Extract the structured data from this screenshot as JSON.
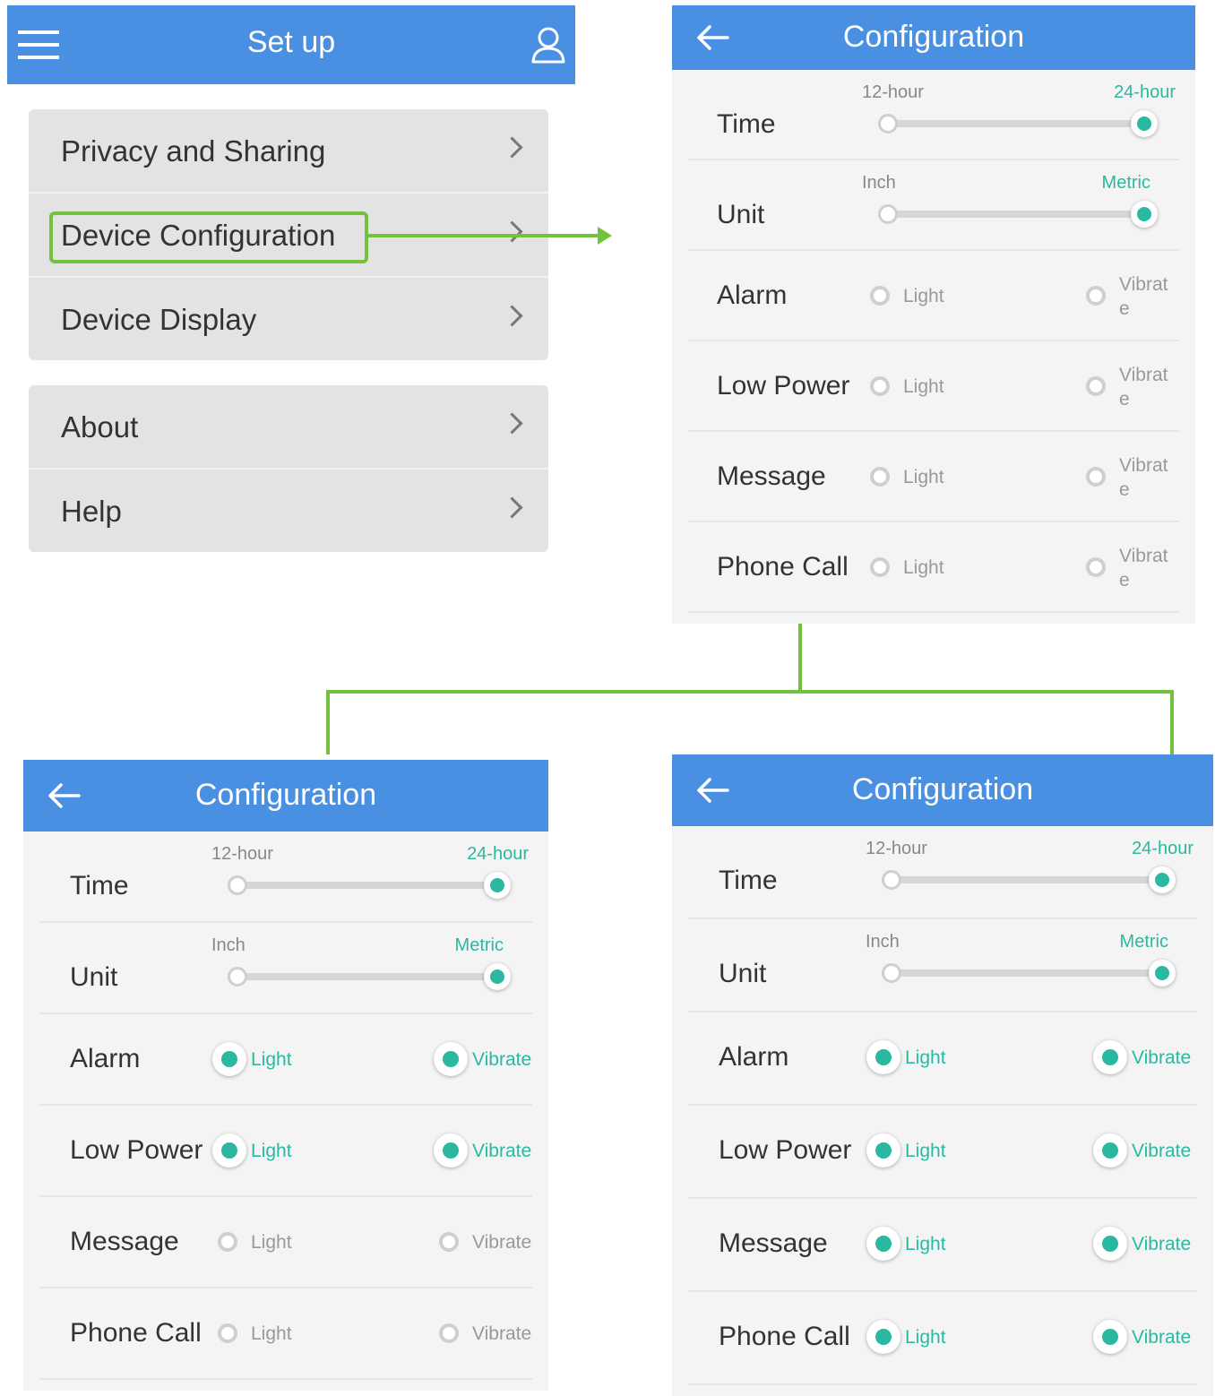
{
  "colors": {
    "accent": "#4a90e2",
    "active": "#2bb8a0",
    "connector": "#72c23e"
  },
  "setup": {
    "title": "Set up",
    "menu_icon": "hamburger-menu-icon",
    "user_icon": "user-icon",
    "group1": [
      "Privacy and Sharing",
      "Device Configuration",
      "Device Display"
    ],
    "group2": [
      "About",
      "Help"
    ],
    "highlighted": "Device Configuration"
  },
  "config_panels": [
    {
      "title": "Configuration",
      "time": {
        "label": "Time",
        "left": "12-hour",
        "right": "24-hour",
        "value": "24-hour"
      },
      "unit": {
        "label": "Unit",
        "left": "Inch",
        "right": "Metric",
        "value": "Metric"
      },
      "options": [
        {
          "label": "Alarm",
          "opt1": "Light",
          "opt2": "Vibrate",
          "opt2_wrapped": "Vibrat\ne",
          "light": false,
          "vibrate": false
        },
        {
          "label": "Low Power",
          "opt1": "Light",
          "opt2": "Vibrate",
          "opt2_wrapped": "Vibrat\ne",
          "light": false,
          "vibrate": false
        },
        {
          "label": "Message",
          "opt1": "Light",
          "opt2": "Vibrate",
          "opt2_wrapped": "Vibrat\ne",
          "light": false,
          "vibrate": false
        },
        {
          "label": "Phone Call",
          "opt1": "Light",
          "opt2": "Vibrate",
          "opt2_wrapped": "Vibrat\ne",
          "light": false,
          "vibrate": false
        }
      ]
    },
    {
      "title": "Configuration",
      "time": {
        "label": "Time",
        "left": "12-hour",
        "right": "24-hour",
        "value": "24-hour"
      },
      "unit": {
        "label": "Unit",
        "left": "Inch",
        "right": "Metric",
        "value": "Metric"
      },
      "options": [
        {
          "label": "Alarm",
          "opt1": "Light",
          "opt2": "Vibrate",
          "light": true,
          "vibrate": true
        },
        {
          "label": "Low Power",
          "opt1": "Light",
          "opt2": "Vibrate",
          "light": true,
          "vibrate": true
        },
        {
          "label": "Message",
          "opt1": "Light",
          "opt2": "Vibrate",
          "light": false,
          "vibrate": false
        },
        {
          "label": "Phone Call",
          "opt1": "Light",
          "opt2": "Vibrate",
          "light": false,
          "vibrate": false
        }
      ]
    },
    {
      "title": "Configuration",
      "time": {
        "label": "Time",
        "left": "12-hour",
        "right": "24-hour",
        "value": "24-hour"
      },
      "unit": {
        "label": "Unit",
        "left": "Inch",
        "right": "Metric",
        "value": "Metric"
      },
      "options": [
        {
          "label": "Alarm",
          "opt1": "Light",
          "opt2": "Vibrate",
          "light": true,
          "vibrate": true
        },
        {
          "label": "Low Power",
          "opt1": "Light",
          "opt2": "Vibrate",
          "light": true,
          "vibrate": true
        },
        {
          "label": "Message",
          "opt1": "Light",
          "opt2": "Vibrate",
          "light": true,
          "vibrate": true
        },
        {
          "label": "Phone Call",
          "opt1": "Light",
          "opt2": "Vibrate",
          "light": true,
          "vibrate": true
        }
      ]
    }
  ]
}
